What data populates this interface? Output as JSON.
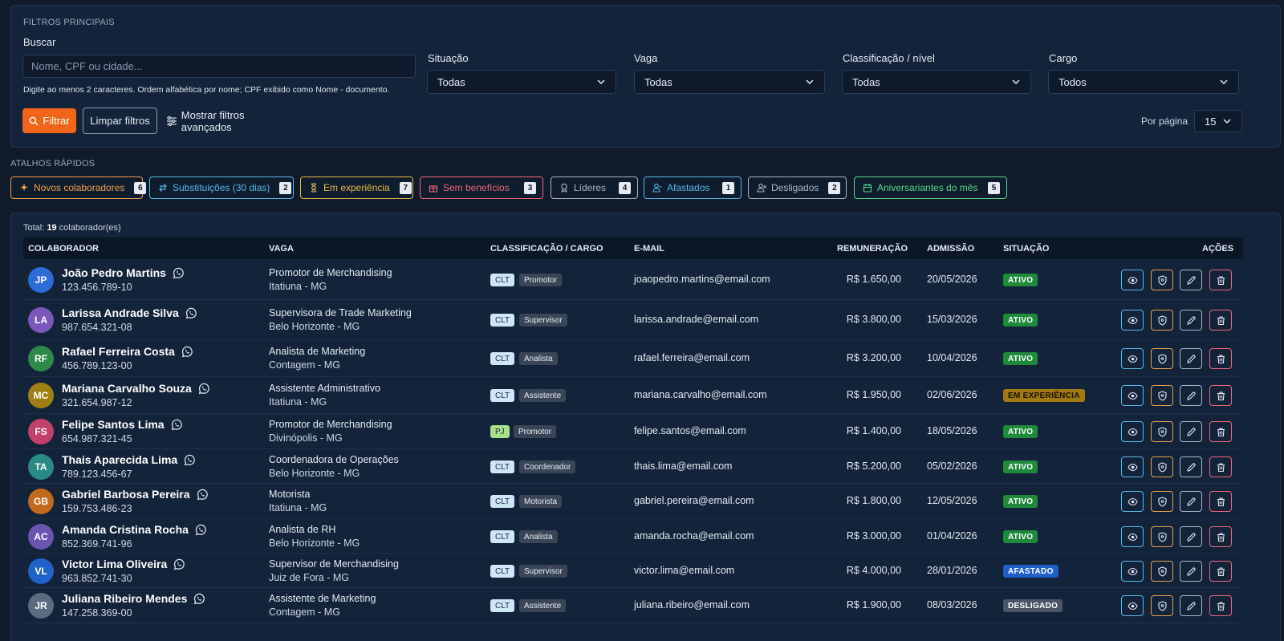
{
  "filters": {
    "section_title": "FILTROS PRINCIPAIS",
    "search_label": "Buscar",
    "search_placeholder": "Nome, CPF ou cidade...",
    "search_hint": "Digite ao menos 2 caracteres. Ordem alfabética por nome; CPF exibido como Nome - documento.",
    "situacao": {
      "label": "Situação",
      "value": "Todas"
    },
    "vaga": {
      "label": "Vaga",
      "value": "Todas"
    },
    "classificacao": {
      "label": "Classificação / nível",
      "value": "Todas"
    },
    "cargo": {
      "label": "Cargo",
      "value": "Todos"
    },
    "filter_button": "Filtrar",
    "clear_button": "Limpar filtros",
    "advanced_button": "Mostrar filtros avançados",
    "per_page_label": "Por página",
    "per_page_value": "15"
  },
  "shortcuts": {
    "section_title": "ATALHOS RÁPIDOS",
    "items": [
      {
        "label": "Novos colaboradores",
        "count": "6",
        "icon": "sparkle-icon",
        "color": "#f0a050"
      },
      {
        "label": "Substituições (30 dias)",
        "count": "2",
        "icon": "swap-icon",
        "color": "#5bb8e8"
      },
      {
        "label": "Em experiência",
        "count": "7",
        "icon": "hourglass-icon",
        "color": "#e8b84a"
      },
      {
        "label": "Sem benefícios",
        "count": "3",
        "icon": "gift-icon",
        "color": "#f06878"
      },
      {
        "label": "Líderes",
        "count": "4",
        "icon": "award-icon",
        "color": "#aab6c6"
      },
      {
        "label": "Afastados",
        "count": "1",
        "icon": "user-minus-icon",
        "color": "#5bb8e8"
      },
      {
        "label": "Desligados",
        "count": "2",
        "icon": "user-x-icon",
        "color": "#aab6c6"
      },
      {
        "label": "Aniversariantes do mês",
        "count": "5",
        "icon": "calendar-icon",
        "color": "#5cd88a"
      }
    ]
  },
  "table": {
    "total_prefix": "Total:",
    "total_count": "19",
    "total_suffix": "colaborador(es)",
    "headers": {
      "colaborador": "COLABORADOR",
      "vaga": "VAGA",
      "classificacao": "CLASSIFICAÇÃO / CARGO",
      "email": "E-MAIL",
      "remuneracao": "REMUNERAÇÃO",
      "admissao": "ADMISSÃO",
      "situacao": "SITUAÇÃO",
      "acoes": "AÇÕES"
    },
    "rows": [
      {
        "initials": "JP",
        "avatar_color": "#2e6bd8",
        "name": "João Pedro Martins",
        "doc": "123.456.789-10",
        "vaga": "Promotor de Merchandising",
        "cidade": "Itatiuna - MG",
        "tipo": "CLT",
        "cargo": "Promotor",
        "email": "joaopedro.martins@email.com",
        "salario": "R$ 1.650,00",
        "admissao": "20/05/2026",
        "status": "ATIVO",
        "status_kind": "ativo"
      },
      {
        "initials": "LA",
        "avatar_color": "#7a57b8",
        "name": "Larissa Andrade Silva",
        "doc": "987.654.321-08",
        "vaga": "Supervisora de Trade Marketing",
        "cidade": "Belo Horizonte - MG",
        "tipo": "CLT",
        "cargo": "Supervisor",
        "email": "larissa.andrade@email.com",
        "salario": "R$ 3.800,00",
        "admissao": "15/03/2026",
        "status": "ATIVO",
        "status_kind": "ativo"
      },
      {
        "initials": "RF",
        "avatar_color": "#2f8a4a",
        "name": "Rafael Ferreira Costa",
        "doc": "456.789.123-00",
        "vaga": "Analista de Marketing",
        "cidade": "Contagem - MG",
        "tipo": "CLT",
        "cargo": "Analista",
        "email": "rafael.ferreira@email.com",
        "salario": "R$ 3.200,00",
        "admissao": "10/04/2026",
        "status": "ATIVO",
        "status_kind": "ativo"
      },
      {
        "initials": "MC",
        "avatar_color": "#a07f12",
        "name": "Mariana Carvalho Souza",
        "doc": "321.654.987-12",
        "vaga": "Assistente Administrativo",
        "cidade": "Itatiuna - MG",
        "tipo": "CLT",
        "cargo": "Assistente",
        "email": "mariana.carvalho@email.com",
        "salario": "R$ 1.950,00",
        "admissao": "02/06/2026",
        "status": "EM EXPERIÊNCIA",
        "status_kind": "experiencia"
      },
      {
        "initials": "FS",
        "avatar_color": "#c2406a",
        "name": "Felipe Santos Lima",
        "doc": "654.987.321-45",
        "vaga": "Promotor de Merchandising",
        "cidade": "Divinópolis - MG",
        "tipo": "PJ",
        "cargo": "Promotor",
        "email": "felipe.santos@email.com",
        "salario": "R$ 1.400,00",
        "admissao": "18/05/2026",
        "status": "ATIVO",
        "status_kind": "ativo"
      },
      {
        "initials": "TA",
        "avatar_color": "#2a8a86",
        "name": "Thais Aparecida Lima",
        "doc": "789.123.456-67",
        "vaga": "Coordenadora de Operações",
        "cidade": "Belo Horizonte - MG",
        "tipo": "CLT",
        "cargo": "Coordenador",
        "email": "thais.lima@email.com",
        "salario": "R$ 5.200,00",
        "admissao": "05/02/2026",
        "status": "ATIVO",
        "status_kind": "ativo"
      },
      {
        "initials": "GB",
        "avatar_color": "#c06a1e",
        "name": "Gabriel Barbosa Pereira",
        "doc": "159.753.486-23",
        "vaga": "Motorista",
        "cidade": "Itatiuna - MG",
        "tipo": "CLT",
        "cargo": "Motorista",
        "email": "gabriel.pereira@email.com",
        "salario": "R$ 1.800,00",
        "admissao": "12/05/2026",
        "status": "ATIVO",
        "status_kind": "ativo"
      },
      {
        "initials": "AC",
        "avatar_color": "#6a54b0",
        "name": "Amanda Cristina Rocha",
        "doc": "852.369.741-96",
        "vaga": "Analista de RH",
        "cidade": "Belo Horizonte - MG",
        "tipo": "CLT",
        "cargo": "Analista",
        "email": "amanda.rocha@email.com",
        "salario": "R$ 3.000,00",
        "admissao": "01/04/2026",
        "status": "ATIVO",
        "status_kind": "ativo"
      },
      {
        "initials": "VL",
        "avatar_color": "#1f62c8",
        "name": "Victor Lima Oliveira",
        "doc": "963.852.741-30",
        "vaga": "Supervisor de Merchandising",
        "cidade": "Juiz de Fora - MG",
        "tipo": "CLT",
        "cargo": "Supervisor",
        "email": "victor.lima@email.com",
        "salario": "R$ 4.000,00",
        "admissao": "28/01/2026",
        "status": "AFASTADO",
        "status_kind": "afastado"
      },
      {
        "initials": "JR",
        "avatar_color": "#5b6b80",
        "name": "Juliana Ribeiro Mendes",
        "doc": "147.258.369-00",
        "vaga": "Assistente de Marketing",
        "cidade": "Contagem - MG",
        "tipo": "CLT",
        "cargo": "Assistente",
        "email": "juliana.ribeiro@email.com",
        "salario": "R$ 1.900,00",
        "admissao": "08/03/2026",
        "status": "DESLIGADO",
        "status_kind": "desligado"
      }
    ]
  },
  "colors": {
    "accent": "#f06519",
    "ativo": "#1f8a3c",
    "experiencia": "#a07a10",
    "afastado": "#1f5fc8",
    "desligado": "#4a5668",
    "clt_bg": "#cfe6f5",
    "pj_bg": "#a9e08a"
  }
}
